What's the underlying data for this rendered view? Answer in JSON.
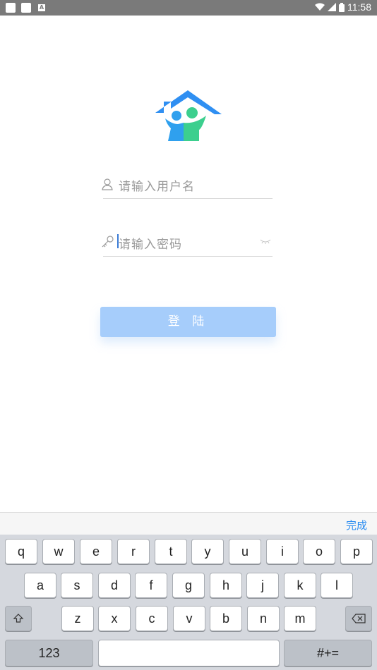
{
  "status_bar": {
    "time": "11:58",
    "icons": [
      "notification-square-icon",
      "notification-square-icon",
      "app-a-icon",
      "wifi-icon",
      "signal-icon",
      "battery-icon"
    ]
  },
  "logo": {
    "icon": "home-family-logo-icon",
    "colors": {
      "roof": "#2f8ff2",
      "left_person": "#2fa0ee",
      "right_person": "#3ccf8e"
    }
  },
  "login": {
    "username_placeholder": "请输入用户名",
    "password_placeholder": "请输入密码",
    "submit_label": "登 陆"
  },
  "keyboard": {
    "done_label": "完成",
    "row1": [
      "q",
      "w",
      "e",
      "r",
      "t",
      "y",
      "u",
      "i",
      "o",
      "p"
    ],
    "row2": [
      "a",
      "s",
      "d",
      "f",
      "g",
      "h",
      "j",
      "k",
      "l"
    ],
    "row3": [
      "z",
      "x",
      "c",
      "v",
      "b",
      "n",
      "m"
    ],
    "shift_icon": "shift-icon",
    "backspace_icon": "backspace-icon",
    "numbers_label": "123",
    "symbols_label": "#+="
  },
  "colors": {
    "accent": "#2b8cf0",
    "button_bg": "#a6cdfb"
  }
}
